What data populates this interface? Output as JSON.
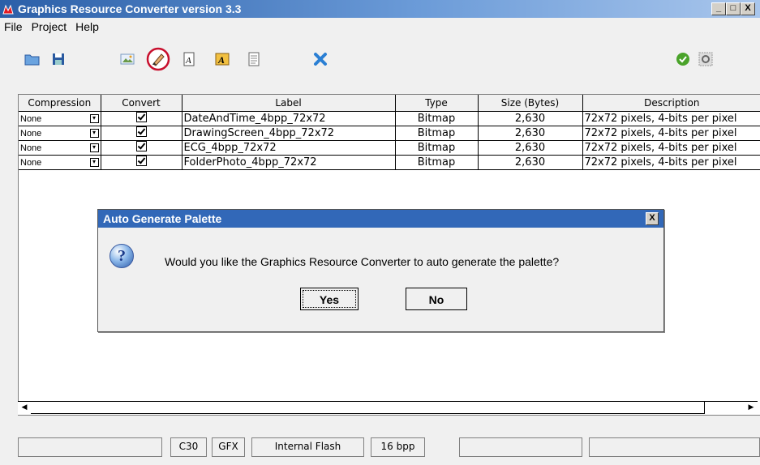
{
  "window": {
    "title": "Graphics Resource Converter version 3.3",
    "minimize": "_",
    "maximize": "□",
    "close": "X"
  },
  "menu": [
    "File",
    "Project",
    "Help"
  ],
  "toolbar": {
    "icons": [
      "open-folder-icon",
      "save-icon",
      "bitmap-icon",
      "brush-palette-icon",
      "font-icon",
      "font-bold-icon",
      "document-icon",
      "delete-x-icon",
      "ok-check-icon",
      "settings-icon"
    ],
    "accent_red": "#c8102e",
    "delete_blue": "#2a7fd4",
    "ok_green": "#4aa32a"
  },
  "grid": {
    "columns": [
      "Compression",
      "Convert",
      "Label",
      "Type",
      "Size (Bytes)",
      "Description"
    ],
    "rows": [
      {
        "compression": "None",
        "convert": true,
        "label": "DateAndTime_4bpp_72x72",
        "type": "Bitmap",
        "size": "2,630",
        "description": "72x72 pixels, 4-bits per pixel"
      },
      {
        "compression": "None",
        "convert": true,
        "label": "DrawingScreen_4bpp_72x72",
        "type": "Bitmap",
        "size": "2,630",
        "description": "72x72 pixels, 4-bits per pixel"
      },
      {
        "compression": "None",
        "convert": true,
        "label": "ECG_4bpp_72x72",
        "type": "Bitmap",
        "size": "2,630",
        "description": "72x72 pixels, 4-bits per pixel"
      },
      {
        "compression": "None",
        "convert": true,
        "label": "FolderPhoto_4bpp_72x72",
        "type": "Bitmap",
        "size": "2,630",
        "description": "72x72 pixels, 4-bits per pixel"
      }
    ]
  },
  "status": {
    "field1": "",
    "compiler": "C30",
    "format": "GFX",
    "memory": "Internal Flash",
    "bpp": "16 bpp",
    "field6": "",
    "field7": ""
  },
  "dialog": {
    "title": "Auto Generate Palette",
    "close": "X",
    "icon": "question-icon",
    "message": "Would you like the Graphics Resource Converter to auto generate the palette?",
    "yes": "Yes",
    "no": "No"
  }
}
